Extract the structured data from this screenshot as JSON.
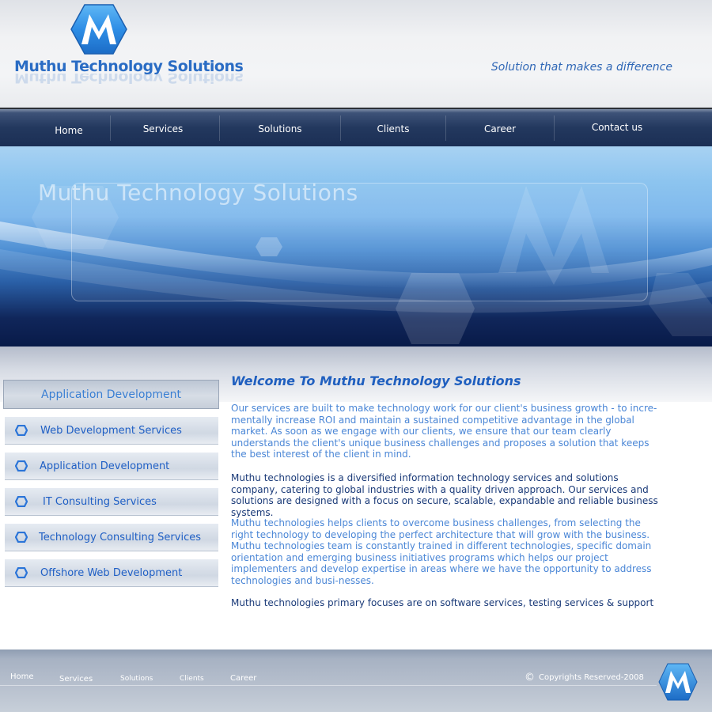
{
  "header": {
    "brand": "Muthu Technology Solutions",
    "tagline": "Solution that makes a difference",
    "logo_icon": "m-hexagon-logo"
  },
  "nav": {
    "items": [
      {
        "label": "Home"
      },
      {
        "label": "Services"
      },
      {
        "label": "Solutions"
      },
      {
        "label": "Clients"
      },
      {
        "label": "Career"
      },
      {
        "label": "Contact us"
      }
    ]
  },
  "banner": {
    "title": "Muthu Technology Solutions"
  },
  "sidebar": {
    "heading": "Application Development",
    "items": [
      {
        "label": "Web Development Services",
        "icon": "hexagon-bullet-icon"
      },
      {
        "label": "Application Development",
        "icon": "hexagon-bullet-icon"
      },
      {
        "label": "IT Consulting Services",
        "icon": "hexagon-bullet-icon"
      },
      {
        "label": "Technology Consulting Services",
        "icon": "hexagon-bullet-icon"
      },
      {
        "label": "Offshore Web Development",
        "icon": "hexagon-bullet-icon"
      }
    ]
  },
  "main": {
    "title": "Welcome To Muthu Technology Solutions",
    "paragraphs": [
      "Our services are built to make technology work for our client's business growth - to incre-mentally increase ROI and maintain a sustained competitive advantage in the global market. As soon as we engage with our clients, we ensure that our team clearly understands the client's unique business challenges and proposes a solution that keeps the best interest of the client in mind.",
      "Muthu technologies is a diversified information technology services and solutions company, catering to global industries with a quality driven approach. Our services and solutions are designed with a focus on secure, scalable, expandable and reliable business systems.",
      "Muthu technologies helps clients to overcome business challenges, from selecting the right technology to developing the perfect architecture that will grow with the business. Muthu technologies team is constantly trained in different technologies, specific domain orientation and emerging business initiatives programs which helps our project implementers and develop expertise in areas where we have the opportunity to address technologies and busi-nesses.",
      "Muthu technologies primary focuses are on software services, testing services & support"
    ]
  },
  "footer": {
    "links": [
      {
        "label": "Home"
      },
      {
        "label": "Services"
      },
      {
        "label": "Solutions"
      },
      {
        "label": "Clients"
      },
      {
        "label": "Career"
      }
    ],
    "copyright_symbol": "©",
    "copyright": "Copyrights Reserved-2008"
  },
  "colors": {
    "accent": "#1f5fbf",
    "nav_bg": "#23385e",
    "link_light": "#4a86d6"
  }
}
